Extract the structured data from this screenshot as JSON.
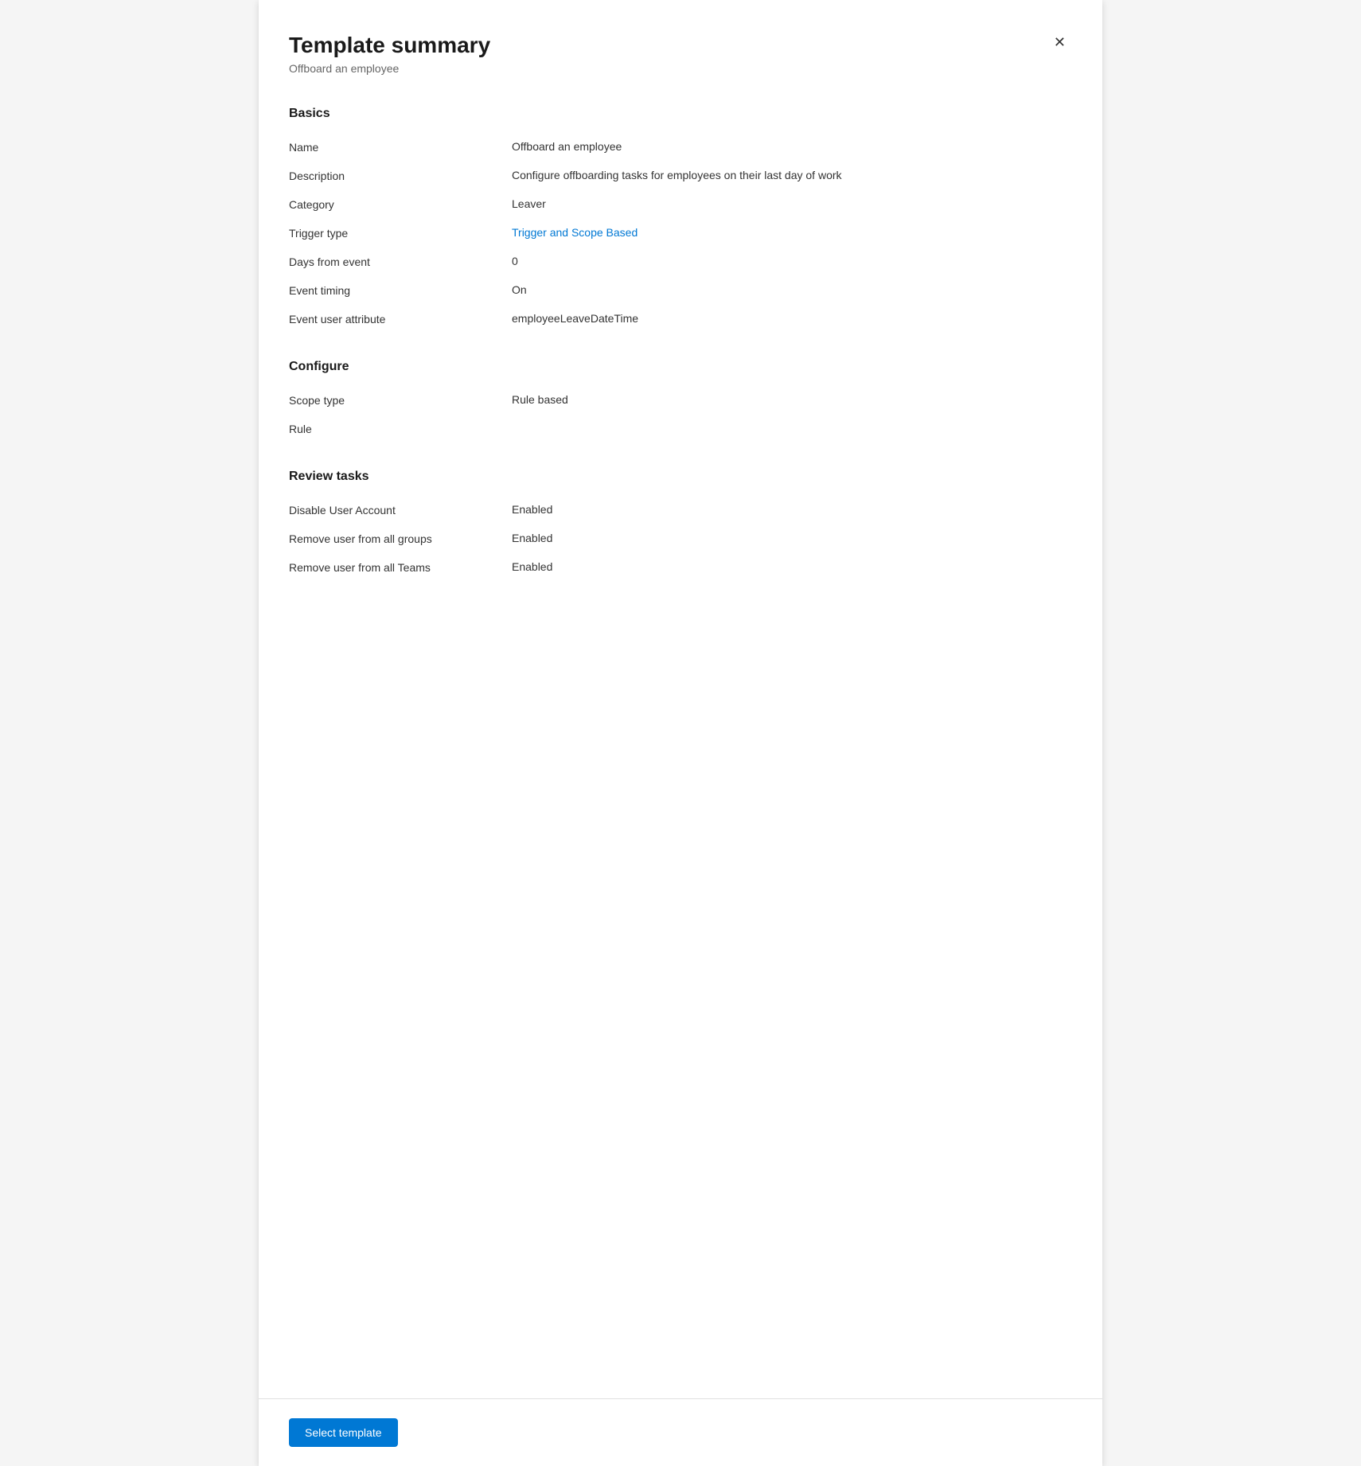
{
  "panel": {
    "title": "Template summary",
    "subtitle": "Offboard an employee",
    "close_icon": "✕"
  },
  "sections": {
    "basics": {
      "title": "Basics",
      "fields": [
        {
          "label": "Name",
          "value": "Offboard an employee",
          "link": false
        },
        {
          "label": "Description",
          "value": "Configure offboarding tasks for employees on their last day of work",
          "link": false
        },
        {
          "label": "Category",
          "value": "Leaver",
          "link": false
        },
        {
          "label": "Trigger type",
          "value": "Trigger and Scope Based",
          "link": true
        },
        {
          "label": "Days from event",
          "value": "0",
          "link": false
        },
        {
          "label": "Event timing",
          "value": "On",
          "link": false
        },
        {
          "label": "Event user attribute",
          "value": "employeeLeaveDateTime",
          "link": false
        }
      ]
    },
    "configure": {
      "title": "Configure",
      "fields": [
        {
          "label": "Scope type",
          "value": "Rule based",
          "link": false
        },
        {
          "label": "Rule",
          "value": "",
          "link": false
        }
      ]
    },
    "review_tasks": {
      "title": "Review tasks",
      "fields": [
        {
          "label": "Disable User Account",
          "value": "Enabled",
          "link": true
        },
        {
          "label": "Remove user from all groups",
          "value": "Enabled",
          "link": true
        },
        {
          "label": "Remove user from all Teams",
          "value": "Enabled",
          "link": true
        }
      ]
    }
  },
  "footer": {
    "select_template_label": "Select template"
  }
}
